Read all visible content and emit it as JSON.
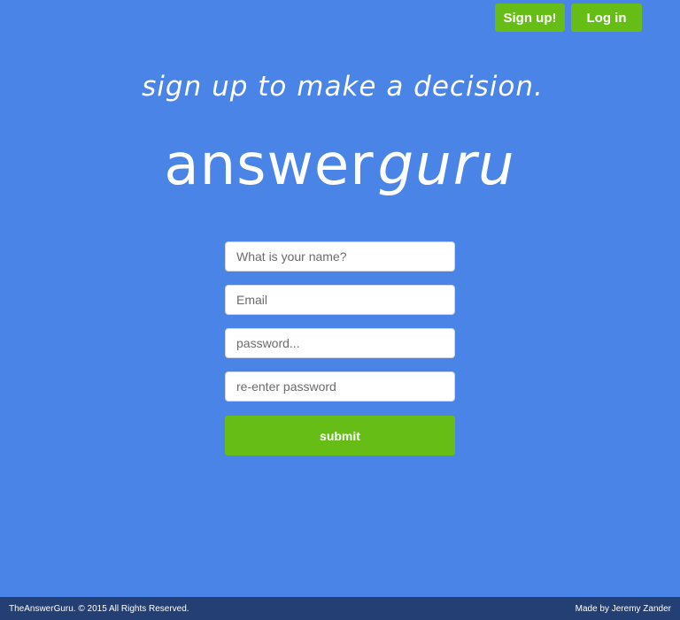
{
  "nav": {
    "signup_label": "Sign up!",
    "login_label": "Log in"
  },
  "hero": {
    "tagline": "sign up to make a decision.",
    "logo_answer": "answer",
    "logo_guru": "guru"
  },
  "form": {
    "name_placeholder": "What is your name?",
    "email_placeholder": "Email",
    "password_placeholder": "password...",
    "confirm_placeholder": "re-enter password",
    "submit_label": "submit"
  },
  "footer": {
    "copyright": "TheAnswerGuru. © 2015 All Rights Reserved.",
    "credit": "Made by Jeremy Zander"
  },
  "colors": {
    "background": "#4a84e6",
    "button": "#65bd16",
    "footer": "#233f73"
  }
}
